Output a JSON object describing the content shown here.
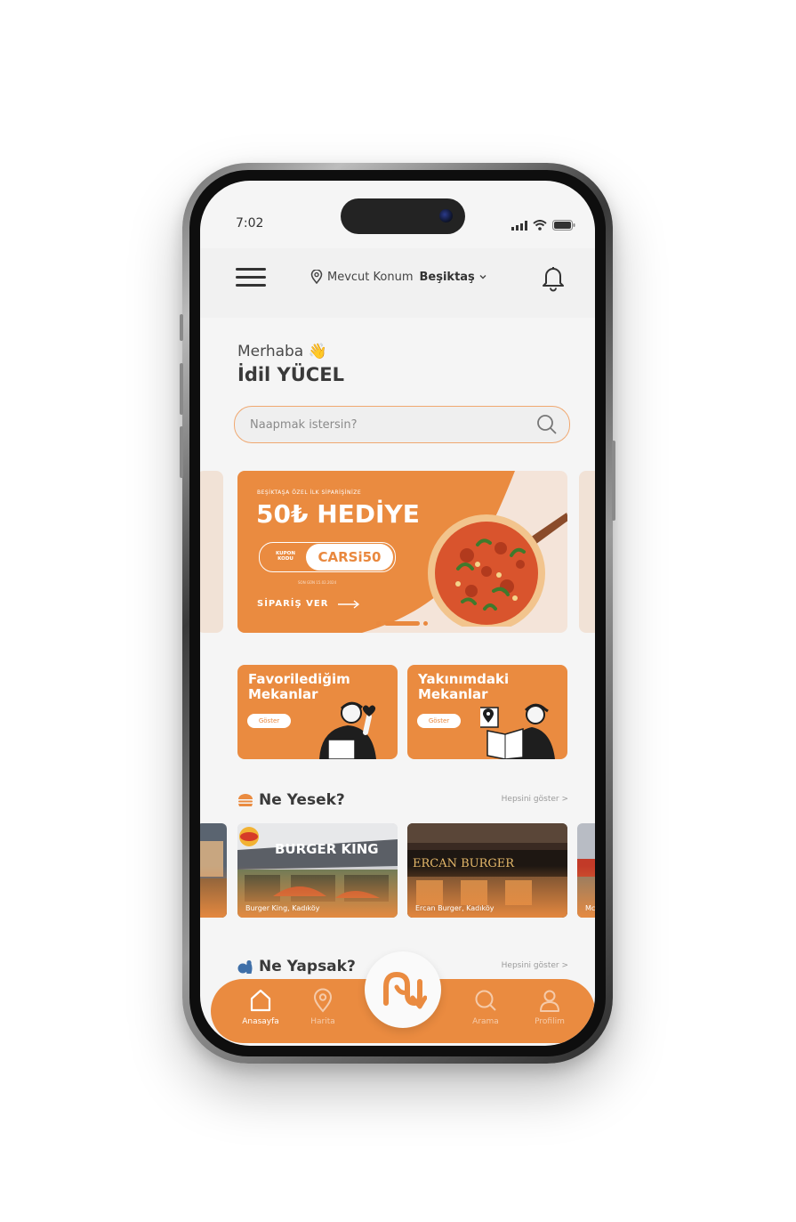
{
  "status_bar": {
    "time": "7:02"
  },
  "header": {
    "location_label": "Mevcut Konum",
    "location_value": "Beşiktaş",
    "icons": [
      "menu-icon",
      "location-pin-icon",
      "chevron-down-icon",
      "bell-icon"
    ]
  },
  "greeting": {
    "hello": "Merhaba",
    "emoji": "👋",
    "user_name": "İdil YÜCEL"
  },
  "search": {
    "placeholder": "Naapmak istersin?"
  },
  "promo": {
    "kicker": "BEŞİKTAŞA ÖZEL İLK SİPARİŞİNİZE",
    "headline": "50₺ HEDİYE",
    "coupon_label": "KUPON KODU",
    "coupon_code": "CARSi50",
    "fine_print": "SON GÜN 15.02.2024",
    "cta": "SİPARİŞ VER",
    "carousel_count": 3,
    "carousel_active": 2,
    "colors": {
      "orange": "#EA8B40",
      "cream": "#F4E4D9"
    }
  },
  "quick_cards": [
    {
      "title": "Favorilediğim Mekanlar",
      "button": "Göster"
    },
    {
      "title": "Yakınımdaki Mekanlar",
      "button": "Göster"
    }
  ],
  "sections": {
    "food": {
      "title": "Ne Yesek?",
      "see_all": "Hepsini göster >",
      "places": [
        {
          "caption": "Burger King, Kadıköy",
          "sign": "BURGER KING"
        },
        {
          "caption": "Ercan Burger, Kadıköy",
          "sign": "ERCAN BURGER"
        },
        {
          "caption": "McD"
        }
      ]
    },
    "activities": {
      "title": "Ne Yapsak?",
      "see_all": "Hepsini göster >"
    }
  },
  "tab_bar": {
    "tabs": [
      {
        "label": "Anasayfa",
        "icon": "home-icon",
        "active": true
      },
      {
        "label": "Harita",
        "icon": "map-pin-icon",
        "active": false
      },
      {
        "label": "Arama",
        "icon": "search-icon",
        "active": false
      },
      {
        "label": "Profilim",
        "icon": "user-icon",
        "active": false
      }
    ],
    "center_logo": "brand-logo-icon"
  },
  "colors": {
    "accent": "#EA8B40",
    "text": "#3A3A3A",
    "background": "#F5F5F5"
  }
}
